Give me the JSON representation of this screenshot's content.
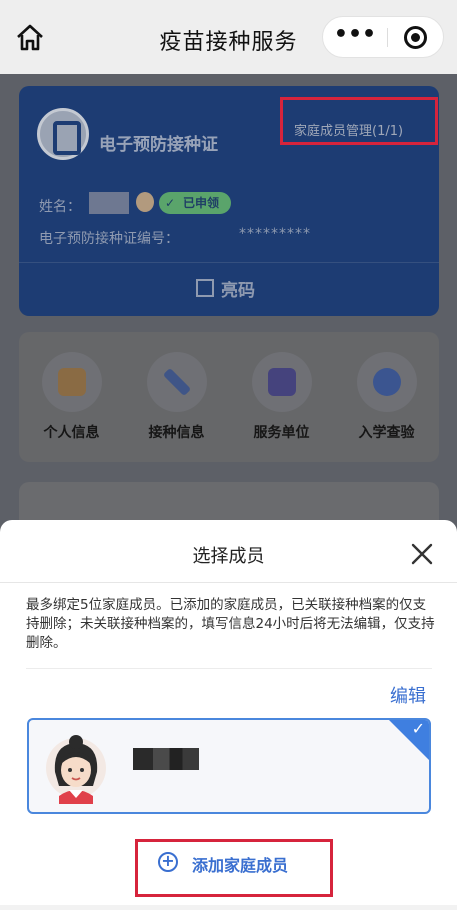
{
  "navbar": {
    "title": "疫苗接种服务",
    "home_icon": "home-icon",
    "more_label": "•••",
    "close_icon": "target-close-icon"
  },
  "certificate": {
    "title": "电子预防接种证",
    "family_manage_link": "家庭成员管理(1/1)",
    "name_label": "姓名：",
    "status_badge": "已申领",
    "cert_no_label": "电子预防接种证编号：",
    "cert_no_value": "*********",
    "show_code_label": "亮码",
    "card_color": "#1d3c73"
  },
  "menu": {
    "items": [
      {
        "label": "个人信息",
        "icon": "id-card-icon",
        "color": "#c98a3b"
      },
      {
        "label": "接种信息",
        "icon": "syringe-icon",
        "color": "#4d6fd0"
      },
      {
        "label": "服务单位",
        "icon": "building-icon",
        "color": "#5a55c8"
      },
      {
        "label": "入学查验",
        "icon": "graduate-icon",
        "color": "#3d6fd6"
      }
    ]
  },
  "sheet": {
    "title": "选择成员",
    "notice": "最多绑定5位家庭成员。已添加的家庭成员，已关联接种档案的仅支持删除；未关联接种档案的，填写信息24小时后将无法编辑，仅支持删除。",
    "edit_label": "编辑",
    "add_member_label": "添加家庭成员",
    "accent_color": "#3a6fd0",
    "highlight_color": "#d6243c"
  }
}
